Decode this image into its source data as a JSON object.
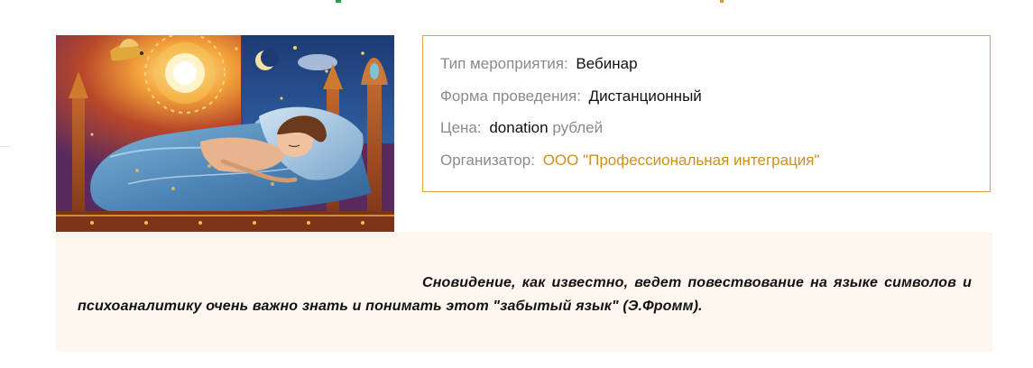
{
  "event_info": {
    "type": {
      "label": "Тип мероприятия:",
      "value": "Вебинар"
    },
    "format": {
      "label": "Форма проведения:",
      "value": "Дистанционный"
    },
    "price": {
      "label": "Цена:",
      "value": "donation",
      "unit": "рублей"
    },
    "organizer": {
      "label": "Организатор:",
      "value": "ООО \"Профессиональная интеграция\""
    }
  },
  "quote": {
    "text": "Сновидение, как известно, ведет повествование на языке символов и психоаналитику очень важно знать и понимать этот \"забытый язык\" (Э.Фромм)."
  },
  "colors": {
    "accent": "#d08e1e",
    "border": "#d9a64a",
    "label": "#8a8a8a",
    "quote_bg": "#fdf7f0"
  },
  "image": {
    "icons": [
      "sun-icon",
      "moon-icon",
      "bird-icon",
      "star-icon"
    ]
  }
}
